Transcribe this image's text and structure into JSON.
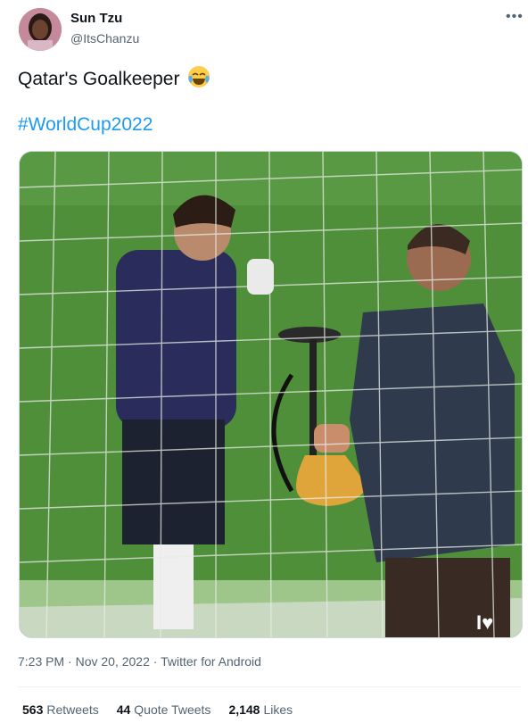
{
  "author": {
    "name": "Sun Tzu",
    "handle": "@ItsChanzu"
  },
  "tweet": {
    "text": "Qatar's Goalkeeper",
    "emoji": "face-with-tears-of-joy",
    "hashtag": "#WorldCup2022"
  },
  "media": {
    "watermark": "I♥"
  },
  "meta": {
    "time": "7:23 PM",
    "date": "Nov 20, 2022",
    "source": "Twitter for Android",
    "sep": "·"
  },
  "stats": {
    "retweets_count": "563",
    "retweets_label": "Retweets",
    "quotes_count": "44",
    "quotes_label": "Quote Tweets",
    "likes_count": "2,148",
    "likes_label": "Likes"
  },
  "colors": {
    "link": "#1d9bf0",
    "secondary_text": "#536471",
    "pitch": "#4f8f3a"
  }
}
